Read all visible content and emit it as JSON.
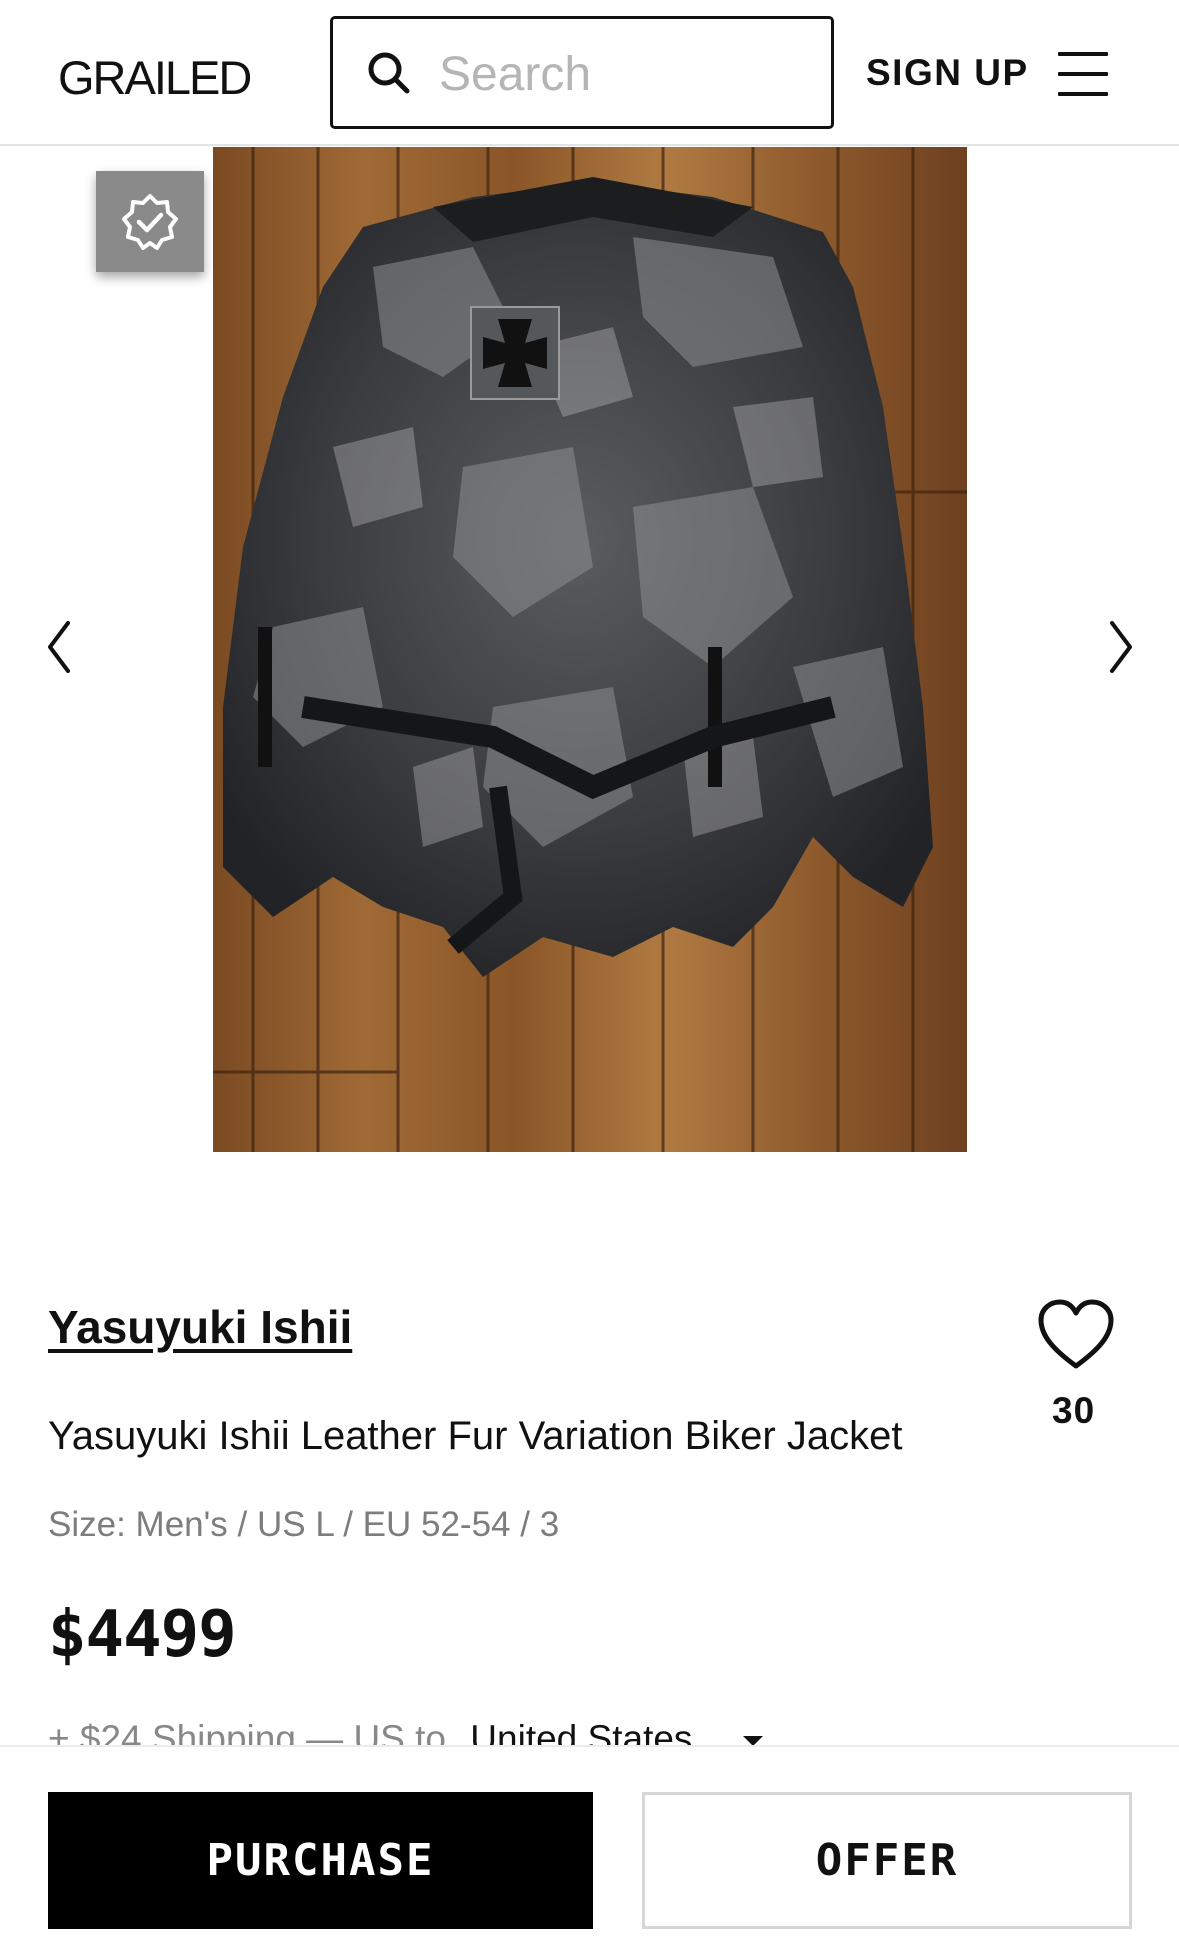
{
  "header": {
    "logo": "GRAILED",
    "search_placeholder": "Search",
    "signup_label": "SIGN UP",
    "menu_icon": "hamburger-menu-icon"
  },
  "gallery": {
    "image_alt": "Yasuyuki Ishii Leather Fur Variation Biker Jacket",
    "verified_icon": "verified-badge-icon",
    "prev_icon": "chevron-left-icon",
    "next_icon": "chevron-right-icon"
  },
  "listing": {
    "brand": "Yasuyuki Ishii",
    "title": "Yasuyuki Ishii Leather Fur Variation Biker Jacket",
    "size": "Size: Men's / US L / EU 52-54 / 3",
    "price": "$4499",
    "shipping_text": "+ $24 Shipping — US to",
    "ship_country": "United States",
    "like_count": "30"
  },
  "actions": {
    "purchase_label": "PURCHASE",
    "offer_label": "OFFER"
  },
  "colors": {
    "primary": "#000000",
    "muted_text": "#7d7d7d",
    "badge_bg": "#8a8a8a"
  }
}
